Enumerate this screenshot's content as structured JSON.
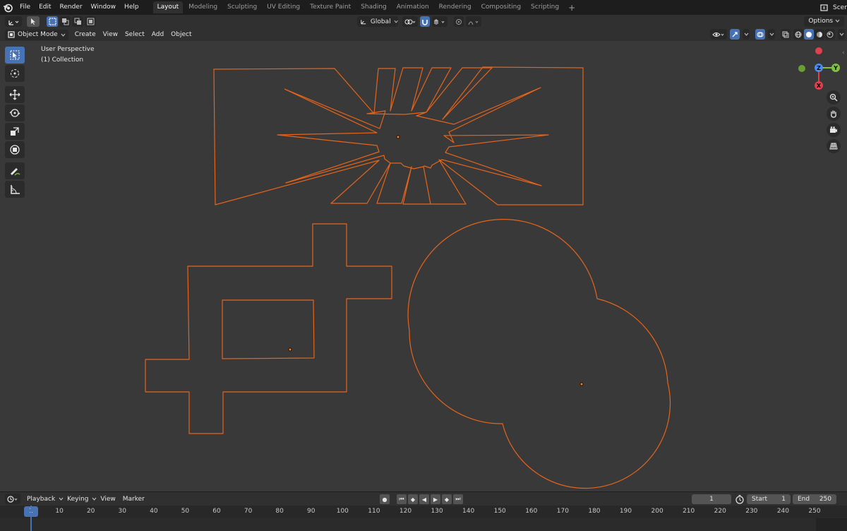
{
  "menus": [
    "File",
    "Edit",
    "Render",
    "Window",
    "Help"
  ],
  "workspaces": [
    "Layout",
    "Modeling",
    "Sculpting",
    "UV Editing",
    "Texture Paint",
    "Shading",
    "Animation",
    "Rendering",
    "Compositing",
    "Scripting"
  ],
  "active_workspace": "Layout",
  "scene_label": "Scene",
  "tool_settings": {
    "transform_orientation": "Global",
    "options_label": "Options"
  },
  "viewport_header": {
    "mode": "Object Mode",
    "menus": [
      "Create",
      "View",
      "Select",
      "Add",
      "Object"
    ]
  },
  "viewport": {
    "perspective_label": "User Perspective",
    "collection_label": "(1) Collection",
    "gizmo_axes": [
      "Z",
      "Y",
      "X"
    ]
  },
  "timeline": {
    "menus": [
      "Playback",
      "Keying",
      "View",
      "Marker"
    ],
    "current_frame": "1",
    "start_label": "Start",
    "start_value": "1",
    "end_label": "End",
    "end_value": "250",
    "ruler_labels": [
      "1",
      "10",
      "20",
      "30",
      "40",
      "50",
      "60",
      "70",
      "80",
      "90",
      "100",
      "110",
      "120",
      "130",
      "140",
      "150",
      "160",
      "170",
      "180",
      "190",
      "200",
      "210",
      "220",
      "230",
      "240",
      "250"
    ]
  },
  "colors": {
    "accent": "#4772b3",
    "curve": "#e5641b",
    "viewport_bg": "#393939",
    "axis_x": "#e0404d",
    "axis_y": "#7fc23b",
    "axis_z": "#4b8ef0"
  }
}
